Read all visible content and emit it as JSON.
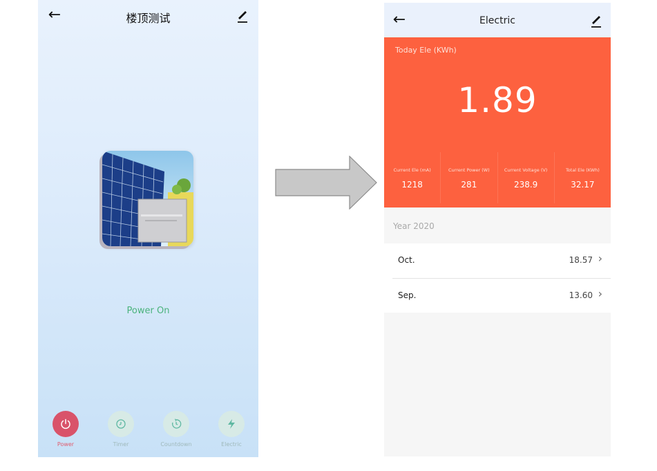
{
  "left_screen": {
    "title": "楼顶测试",
    "status": "Power On",
    "tabs": [
      {
        "label": "Power",
        "icon": "power-icon",
        "active": true
      },
      {
        "label": "Timer",
        "icon": "timer-icon",
        "active": false
      },
      {
        "label": "Countdown",
        "icon": "countdown-icon",
        "active": false
      },
      {
        "label": "Electric",
        "icon": "lightning-icon",
        "active": false
      }
    ]
  },
  "right_screen": {
    "title": "Electric",
    "today_label": "Today Ele (KWh)",
    "today_value": "1.89",
    "stats": [
      {
        "label": "Current Ele (mA)",
        "value": "1218"
      },
      {
        "label": "Current Power (W)",
        "value": "281"
      },
      {
        "label": "Current Voltage (V)",
        "value": "238.9"
      },
      {
        "label": "Total Ele (KWh)",
        "value": "32.17"
      }
    ],
    "year_label": "Year 2020",
    "months": [
      {
        "name": "Oct.",
        "value": "18.57"
      },
      {
        "name": "Sep.",
        "value": "13.60"
      }
    ]
  },
  "colors": {
    "accent_orange": "#fd613f",
    "power_active": "#d9536a",
    "status_green": "#4bb37d"
  }
}
